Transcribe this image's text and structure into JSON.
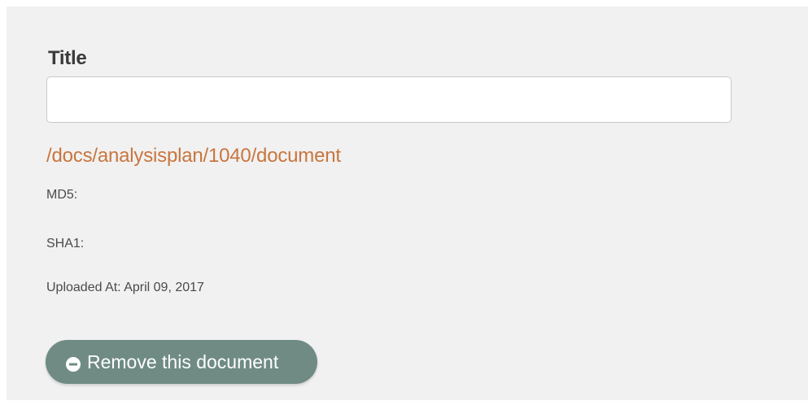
{
  "form": {
    "title_label": "Title",
    "title_value": "",
    "title_placeholder": ""
  },
  "document": {
    "link_text": "/docs/analysisplan/1040/document",
    "md5_label": "MD5:",
    "sha1_label": "SHA1:",
    "uploaded_label": "Uploaded At: April 09, 2017"
  },
  "actions": {
    "remove_label": "Remove this document",
    "remove_icon": "minus-circle-icon"
  },
  "colors": {
    "link": "#c8763e",
    "button_bg": "#6f8b84",
    "panel_bg": "#f1f1f1"
  }
}
